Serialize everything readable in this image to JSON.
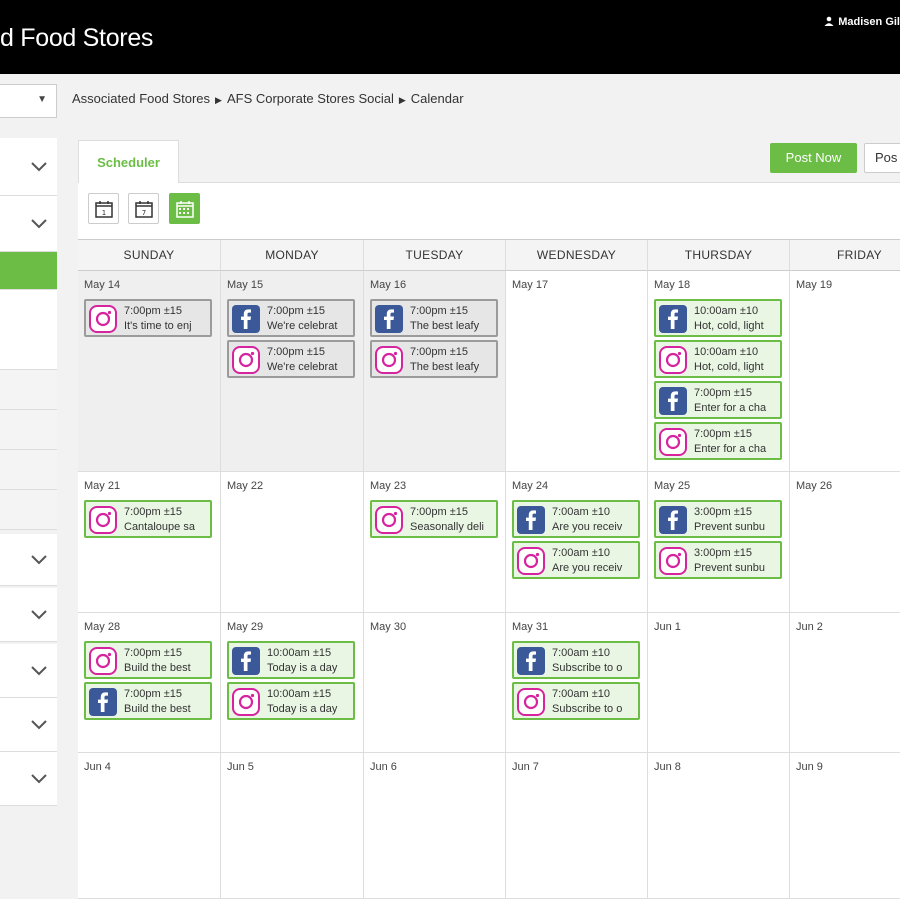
{
  "header": {
    "brand": "d Food Stores",
    "user_name": "Madisen Gil"
  },
  "breadcrumb": [
    "Associated Food Stores",
    "AFS Corporate Stores Social",
    "Calendar"
  ],
  "tabs": {
    "scheduler": "Scheduler"
  },
  "actions": {
    "post_now": "Post Now",
    "post_other": "Pos"
  },
  "colors": {
    "accent": "#6cbd45",
    "facebook": "#3b5998",
    "instagram": "#d6249f"
  },
  "days": [
    "SUNDAY",
    "MONDAY",
    "TUESDAY",
    "WEDNESDAY",
    "THURSDAY",
    "FRIDAY"
  ],
  "weeks": [
    [
      "May 14",
      "May 15",
      "May 16",
      "May 17",
      "May 18",
      "May 19"
    ],
    [
      "May 21",
      "May 22",
      "May 23",
      "May 24",
      "May 25",
      "May 26"
    ],
    [
      "May 28",
      "May 29",
      "May 30",
      "May 31",
      "Jun 1",
      "Jun 2"
    ],
    [
      "Jun 4",
      "Jun 5",
      "Jun 6",
      "Jun 7",
      "Jun 8",
      "Jun 9"
    ]
  ],
  "posts": {
    "w0": {
      "sun": [
        {
          "time": "7:00pm ±15",
          "text": "It's time to enj",
          "net": "instagram"
        }
      ],
      "mon": [
        {
          "time": "7:00pm ±15",
          "text": "We're celebrat",
          "net": "facebook"
        },
        {
          "time": "7:00pm ±15",
          "text": "We're celebrat",
          "net": "instagram"
        }
      ],
      "tue": [
        {
          "time": "7:00pm ±15",
          "text": "The best leafy",
          "net": "facebook"
        },
        {
          "time": "7:00pm ±15",
          "text": "The best leafy",
          "net": "instagram"
        }
      ],
      "thu": [
        {
          "time": "10:00am ±10",
          "text": "Hot, cold, light",
          "net": "facebook"
        },
        {
          "time": "10:00am ±10",
          "text": "Hot, cold, light",
          "net": "instagram"
        },
        {
          "time": "7:00pm ±15",
          "text": "Enter for a cha",
          "net": "facebook"
        },
        {
          "time": "7:00pm ±15",
          "text": "Enter for a cha",
          "net": "instagram"
        }
      ]
    },
    "w1": {
      "sun": [
        {
          "time": "7:00pm ±15",
          "text": "Cantaloupe sa",
          "net": "instagram"
        }
      ],
      "tue": [
        {
          "time": "7:00pm ±15",
          "text": "Seasonally deli",
          "net": "instagram"
        }
      ],
      "wed": [
        {
          "time": "7:00am ±10",
          "text": "Are you receiv",
          "net": "facebook"
        },
        {
          "time": "7:00am ±10",
          "text": "Are you receiv",
          "net": "instagram"
        }
      ],
      "thu": [
        {
          "time": "3:00pm ±15",
          "text": "Prevent sunbu",
          "net": "facebook"
        },
        {
          "time": "3:00pm ±15",
          "text": "Prevent sunbu",
          "net": "instagram"
        }
      ]
    },
    "w2": {
      "sun": [
        {
          "time": "7:00pm ±15",
          "text": "Build the best",
          "net": "instagram"
        },
        {
          "time": "7:00pm ±15",
          "text": "Build the best",
          "net": "facebook"
        }
      ],
      "mon": [
        {
          "time": "10:00am ±15",
          "text": "Today is a day",
          "net": "facebook"
        },
        {
          "time": "10:00am ±15",
          "text": "Today is a day",
          "net": "instagram"
        }
      ],
      "wed": [
        {
          "time": "7:00am ±10",
          "text": "Subscribe to o",
          "net": "facebook"
        },
        {
          "time": "7:00am ±10",
          "text": "Subscribe to o",
          "net": "instagram"
        }
      ]
    }
  }
}
